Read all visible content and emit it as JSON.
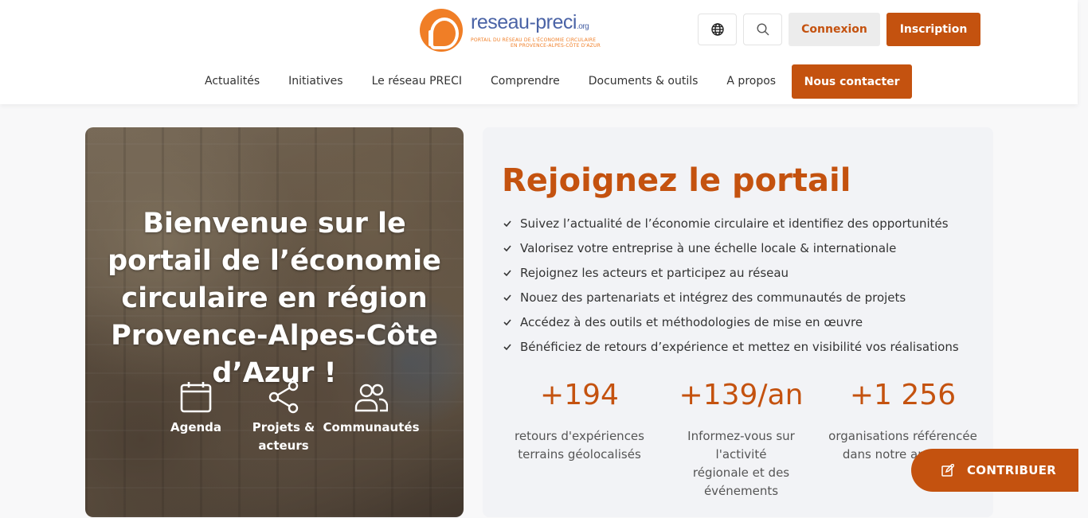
{
  "brand": {
    "name": "reseau-preci",
    "tld": ".org",
    "tagline_line1": "PORTAIL DU RÉSEAU DE L'ÉCONOMIE CIRCULAIRE",
    "tagline_line2": "EN PROVENCE-ALPES-CÔTE D'AZUR",
    "primary_color": "#c4520f",
    "logo_orange": "#f07e26",
    "logo_blue": "#4a63a6"
  },
  "header": {
    "language_icon": "globe-icon",
    "search_icon": "search-icon",
    "login_label": "Connexion",
    "signup_label": "Inscription"
  },
  "nav": {
    "items": [
      {
        "label": "Actualités"
      },
      {
        "label": "Initiatives"
      },
      {
        "label": "Le réseau PRECI"
      },
      {
        "label": "Comprendre"
      },
      {
        "label": "Documents & outils"
      },
      {
        "label": "A propos"
      }
    ],
    "cta_label": "Nous contacter"
  },
  "hero": {
    "title": "Bienvenue sur le portail de l’économie circulaire en région Provence-Alpes-Côte d’Azur !",
    "links": [
      {
        "label": "Agenda",
        "icon": "calendar-icon"
      },
      {
        "label": "Projets & acteurs",
        "icon": "share-icon"
      },
      {
        "label": "Communautés",
        "icon": "users-icon"
      }
    ]
  },
  "join": {
    "title": "Rejoignez le portail",
    "benefits": [
      "Suivez l’actualité de l’économie circulaire et identifiez des opportunités",
      "Valorisez votre entreprise à une échelle locale & internationale",
      "Rejoignez les acteurs et participez au réseau",
      "Nouez des partenariats et intégrez des communautés de projets",
      "Accédez à des outils et méthodologies de mise en œuvre",
      "Bénéficiez de retours d’expérience et mettez en visibilité vos réalisations"
    ],
    "stats": [
      {
        "value": "+194",
        "label_line1": "retours d'expériences",
        "label_line2": "terrains géolocalisés"
      },
      {
        "value": "+139/an",
        "label_line1": "Informez-vous sur l'activité",
        "label_line2": "régionale et des événements"
      },
      {
        "value": "+1 256",
        "label_line1": "organisations référencée",
        "label_line2": "dans notre annuaire"
      }
    ]
  },
  "contribute": {
    "label": "CONTRIBUER",
    "icon": "edit-icon"
  }
}
